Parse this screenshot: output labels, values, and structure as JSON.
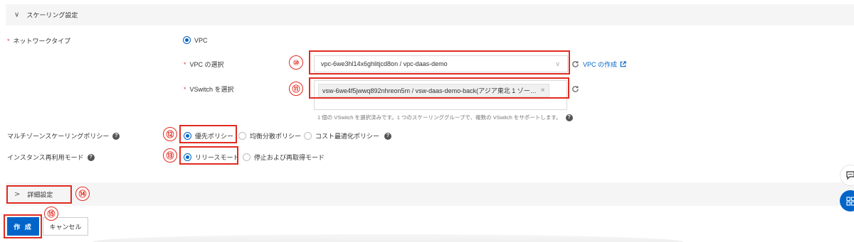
{
  "scaling_section": {
    "title": "スケーリング設定"
  },
  "network_type": {
    "label": "ネットワークタイプ",
    "option": "VPC",
    "vpc": {
      "label": "VPC の選択",
      "value": "vpc-6we3hl14x6ghlitjcd8on / vpc-daas-demo",
      "create_link": "VPC の作成"
    },
    "vswitch": {
      "label": "VSwitch を選択",
      "tag": "vsw-6we4f5jwwq892nhreon5m / vsw-daas-demo-back(アジア東北 1 ゾー…",
      "help": "1 個の VSwitch を選択済みです。1 つのスケーリンググループで、複数の VSwitch をサポートします。"
    }
  },
  "multi_zone_policy": {
    "label": "マルチゾーンスケーリングポリシー",
    "options": [
      "優先ポリシー",
      "均衡分散ポリシー",
      "コスト最適化ポリシー"
    ],
    "selected": "優先ポリシー"
  },
  "instance_reuse_mode": {
    "label": "インスタンス再利用モード",
    "options": [
      "リリースモード",
      "停止および再取得モード"
    ],
    "selected": "リリースモード"
  },
  "advanced_section": {
    "title": "詳細設定"
  },
  "actions": {
    "create": "作 成",
    "cancel": "キャンセル"
  },
  "callouts": [
    "⑩",
    "⑪",
    "⑫",
    "⑬",
    "⑭",
    "⑮"
  ],
  "colors": {
    "accent": "#0064c8",
    "annotation": "#e12b20",
    "required": "#e5434b"
  },
  "icons": [
    "chevron-down-icon",
    "chevron-right-icon",
    "refresh-icon",
    "external-link-icon",
    "help-icon",
    "clear-icon",
    "feedback-icon",
    "apps-icon"
  ]
}
